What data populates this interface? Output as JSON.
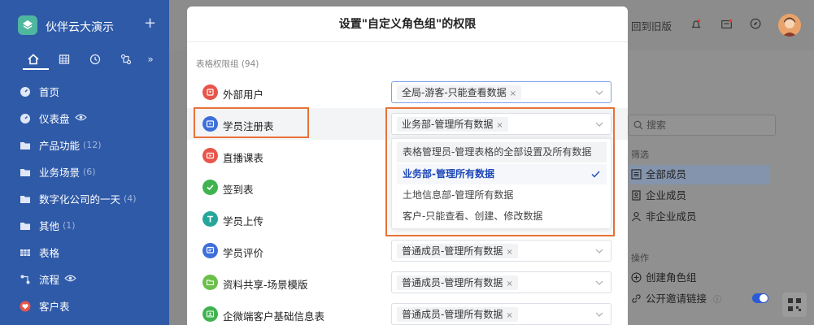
{
  "app": {
    "name": "伙伴云大演示",
    "plus": "+"
  },
  "sidebar": {
    "items": [
      {
        "label": "首页",
        "count": "",
        "icon": "gauge-icon"
      },
      {
        "label": "仪表盘",
        "count": "",
        "icon": "gauge-icon",
        "eye": true
      },
      {
        "label": "产品功能",
        "count": "(12)",
        "icon": "folder-icon"
      },
      {
        "label": "业务场景",
        "count": "(6)",
        "icon": "folder-icon"
      },
      {
        "label": "数字化公司的一天",
        "count": "(4)",
        "icon": "folder-icon"
      },
      {
        "label": "其他",
        "count": "(1)",
        "icon": "folder-icon"
      },
      {
        "label": "表格",
        "count": "",
        "icon": "table-icon"
      },
      {
        "label": "流程",
        "count": "",
        "icon": "flow-icon",
        "eye": true
      },
      {
        "label": "客户表",
        "count": "",
        "icon": "heart-icon"
      }
    ]
  },
  "topbar": {
    "back_old": "回到旧版"
  },
  "right_panel": {
    "search_placeholder": "搜索",
    "filter_label": "筛选",
    "filters": [
      "全部成员",
      "企业成员",
      "非企业成员"
    ],
    "ops_label": "操作",
    "ops": [
      "创建角色组",
      "公开邀请链接"
    ]
  },
  "modal": {
    "title": "设置\"自定义角色组\"的权限",
    "group_label": "表格权限组 (94)",
    "rows": [
      {
        "name": "外部用户",
        "value": "全局-游客-只能查看数据",
        "icon_color": "#e8554a"
      },
      {
        "name": "学员注册表",
        "value": "业务部-管理所有数据",
        "icon_color": "#3d6fd9"
      },
      {
        "name": "直播课表",
        "value": "",
        "icon_color": "#e8554a"
      },
      {
        "name": "签到表",
        "value": "",
        "icon_color": "#3fb34f"
      },
      {
        "name": "学员上传",
        "value": "",
        "icon_color": "#26a69a"
      },
      {
        "name": "学员评价",
        "value": "普通成员-管理所有数据",
        "icon_color": "#3d6fd9"
      },
      {
        "name": "资料共享-场景模版",
        "value": "普通成员-管理所有数据",
        "icon_color": "#6cc04a"
      },
      {
        "name": "企微端客户基础信息表",
        "value": "普通成员-管理所有数据",
        "icon_color": "#3fb34f"
      }
    ],
    "dropdown": [
      "表格管理员-管理表格的全部设置及所有数据",
      "业务部-管理所有数据",
      "土地信息部-管理所有数据",
      "客户-只能查看、创建、修改数据"
    ]
  },
  "colors": {
    "sidebar": "#2f5aa8",
    "accent_orange": "#e8713a",
    "selected_blue": "#1d47b8"
  }
}
